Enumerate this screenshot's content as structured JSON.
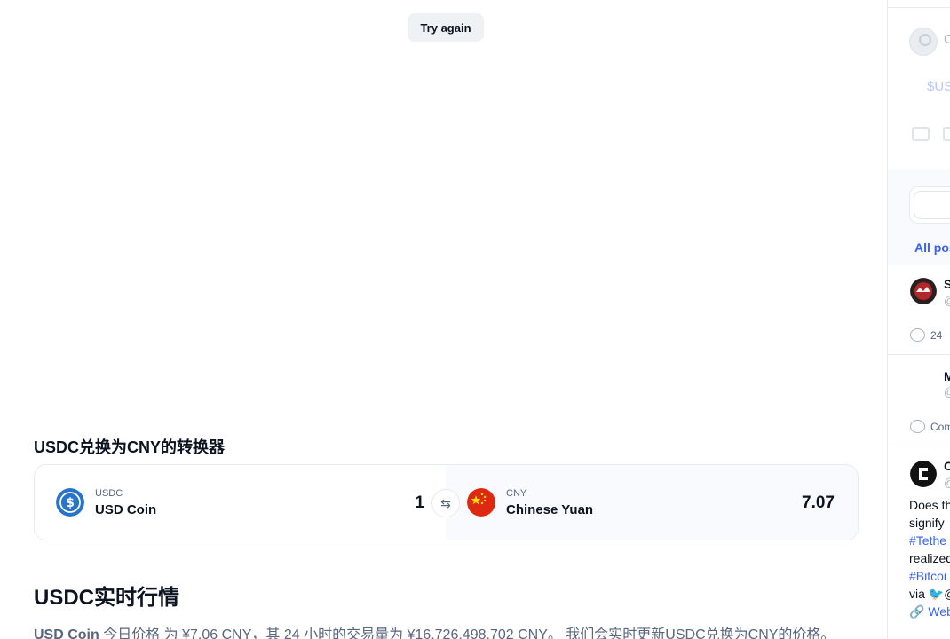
{
  "try_again": "Try again",
  "converter": {
    "title": "USDC兑换为CNY的转换器",
    "from": {
      "symbol": "USDC",
      "name": "USD Coin",
      "amount": "1"
    },
    "to": {
      "symbol": "CNY",
      "name": "Chinese Yuan",
      "amount": "7.07"
    },
    "swap_icon": "swap-arrows-icon"
  },
  "market": {
    "title": "USDC实时行情",
    "desc_coin": "USD Coin",
    "desc_rest": " 今日价格 为 ¥7.06 CNY，其 24 小时的交易量为 ¥16,726,498,702 CNY。 我们会实时更新USDC兑换为CNY的价格。"
  },
  "sidebar": {
    "composer_initial": "C",
    "composer_ticker": "$US",
    "all_posts_tab": "All pos",
    "posts": [
      {
        "name_initial": "S",
        "handle": "@",
        "comment_count": "24"
      },
      {
        "name_initial": "M",
        "handle": "@",
        "comment_label": "Com"
      },
      {
        "name_initial": "C",
        "handle": "@",
        "lines": [
          "Does th",
          "signify",
          "#Tethe",
          "realized",
          "#Bitcoi",
          "via ",
          "Web"
        ],
        "link_line_icon": "link-icon",
        "via_icon": "twitter-bird-icon"
      }
    ]
  },
  "colors": {
    "accent": "#3861fb",
    "text": "#0d1421",
    "muted": "#58667e",
    "usdc_blue": "#2775ca",
    "cny_red": "#de2910"
  }
}
